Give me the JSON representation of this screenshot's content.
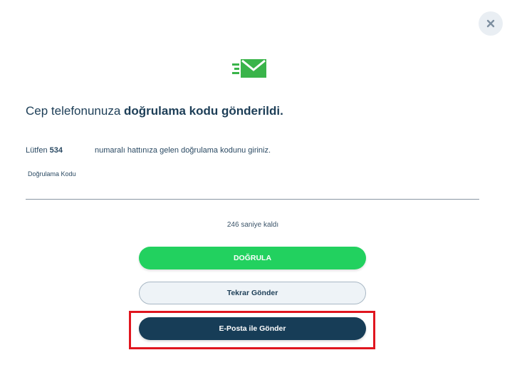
{
  "dialog": {
    "close_icon": "close-icon",
    "mail_icon": "mail-sent-icon",
    "accent_color": "#22d15f",
    "headline_prefix": "Cep telefonunuza ",
    "headline_bold": "doğrulama kodu gönderildi.",
    "info_prefix": "Lütfen ",
    "info_number": "534",
    "info_suffix": "numaralı hattınıza gelen doğrulama kodunu giriniz.",
    "code_label": "Doğrulama Kodu",
    "code_value": "",
    "countdown": "246 saniye kaldı"
  },
  "buttons": {
    "verify_label": "DOĞRULA",
    "resend_label": "Tekrar Gönder",
    "email_label": "E-Posta ile Gönder"
  },
  "colors": {
    "primary_green": "#22d15f",
    "navy": "#173d57",
    "highlight_red": "#e0161f"
  }
}
